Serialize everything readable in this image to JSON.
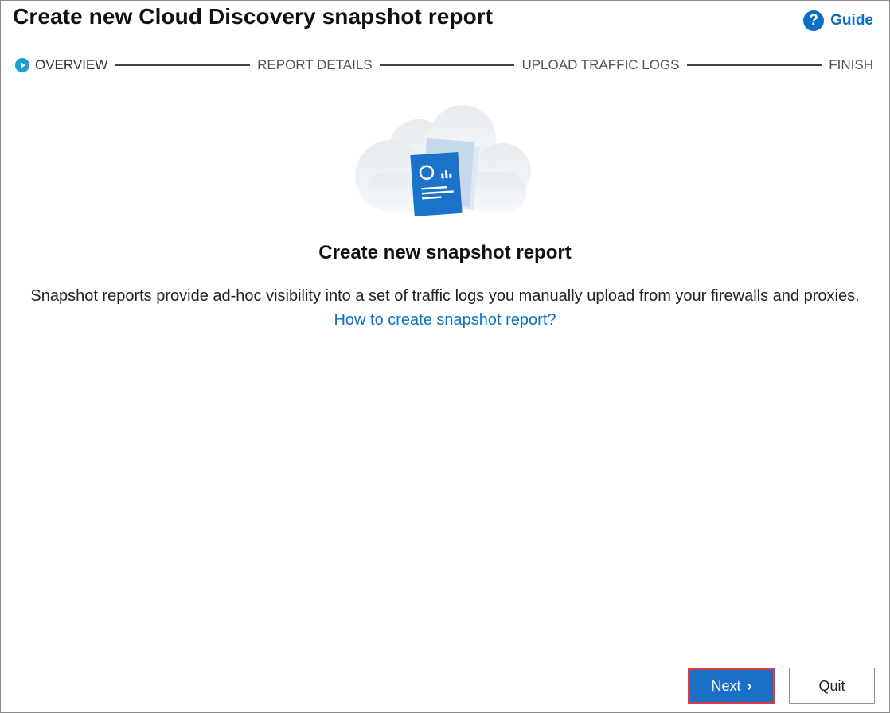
{
  "dialog": {
    "title": "Create new Cloud Discovery snapshot report",
    "guide": {
      "icon": "question-circle-icon",
      "label": "Guide"
    }
  },
  "stepper": {
    "steps": [
      {
        "label": "OVERVIEW",
        "active": true
      },
      {
        "label": "REPORT DETAILS",
        "active": false
      },
      {
        "label": "UPLOAD TRAFFIC LOGS",
        "active": false
      },
      {
        "label": "FINISH",
        "active": false
      }
    ]
  },
  "content": {
    "illustration": "snapshot-report-cloud-illustration",
    "heading": "Create new snapshot report",
    "description": "Snapshot reports provide ad-hoc visibility into a set of traffic logs you manually upload from your firewalls and proxies.",
    "link": "How to create snapshot report?"
  },
  "footer": {
    "next_label": "Next",
    "next_icon": "chevron-right-icon",
    "quit_label": "Quit"
  },
  "colors": {
    "accent": "#0a6fc4",
    "primary_button": "#1a6fc7",
    "step_active_dot": "#1aa0d8",
    "highlight_border": "#d9394a"
  }
}
